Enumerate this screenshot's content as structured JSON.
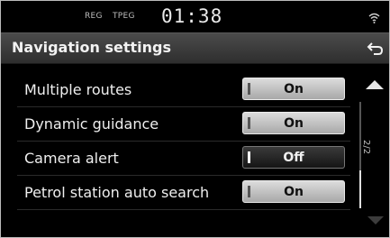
{
  "status_bar": {
    "reg_label": "REG",
    "tpeg_label": "TPEG",
    "clock": "01:38",
    "signal_icon": "wifi-icon"
  },
  "header": {
    "title": "Navigation settings",
    "back_icon": "back-arrow-icon"
  },
  "settings": [
    {
      "label": "Multiple routes",
      "value": "On"
    },
    {
      "label": "Dynamic guidance",
      "value": "On"
    },
    {
      "label": "Camera alert",
      "value": "Off"
    },
    {
      "label": "Petrol station auto search",
      "value": "On"
    }
  ],
  "scrollbar": {
    "page_indicator": "2/2",
    "up_icon": "scroll-up-icon",
    "down_icon": "scroll-down-icon"
  },
  "colors": {
    "background": "#000000",
    "title_bar": "#3a3a3a",
    "toggle_on": "#c8c8c8",
    "toggle_off": "#222222",
    "text": "#efefef"
  }
}
